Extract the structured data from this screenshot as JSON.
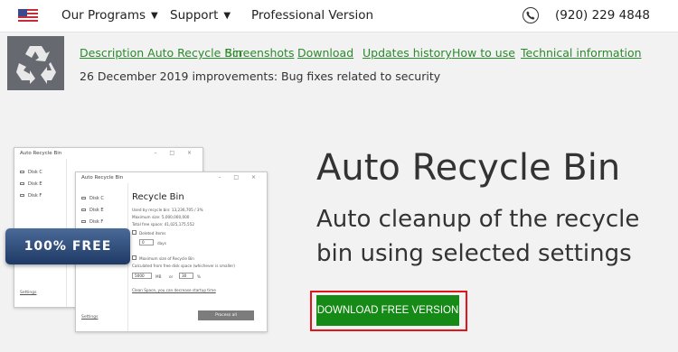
{
  "nav": {
    "flag_icon": "us-flag-icon",
    "items": [
      {
        "label": "Our Programs",
        "has_dropdown": true
      },
      {
        "label": "Support",
        "has_dropdown": true
      },
      {
        "label": "Professional Version",
        "has_dropdown": false
      }
    ],
    "phone": "(920) 229 4848"
  },
  "product": {
    "logo_icon": "recycle-icon",
    "links": [
      "Description Auto Recycle Bin",
      "Screenshots",
      "Download",
      "Updates history",
      "How to use",
      "Technical information"
    ],
    "update_note": "26 December 2019 improvements: Bug fixes related to security"
  },
  "screenshot": {
    "back_window": {
      "title": "Auto Recycle Bin",
      "disks": [
        "Disk C",
        "Disk E",
        "Disk F"
      ],
      "settings_label": "Settings"
    },
    "front_window": {
      "title": "Auto Recycle Bin",
      "disks": [
        "Disk C",
        "Disk E",
        "Disk F"
      ],
      "heading": "Recycle Bin",
      "used": "Used by recycle bin: 13,236,705 / 3%",
      "maximum": "Maximum size: 5,000,000,000",
      "free": "Total free space: 41,025,175,552",
      "deleted_items_label": "Deleted items",
      "days_value": "0",
      "days_label": "days",
      "max_size_label": "Maximum size of Recycle Bin",
      "calc_label": "Calculated from free disk space (whichever is smaller)",
      "size_value": "5000",
      "size_unit": "MB",
      "or_label": "or",
      "percent_value": "30",
      "percent_unit": "%",
      "cleanup_link": "Clean Space, you can decrease startup time",
      "process_button": "Process all",
      "settings_label": "Settings"
    },
    "ribbon": "100% FREE"
  },
  "hero": {
    "title": "Auto Recycle Bin",
    "subtitle": "Auto cleanup of the recycle bin using selected settings",
    "download_button": "DOWNLOAD FREE VERSION"
  },
  "colors": {
    "link_green": "#2b8a2b",
    "button_green": "#168a16",
    "highlight_red": "#e3151b",
    "ribbon_blue": "#2a4675"
  }
}
